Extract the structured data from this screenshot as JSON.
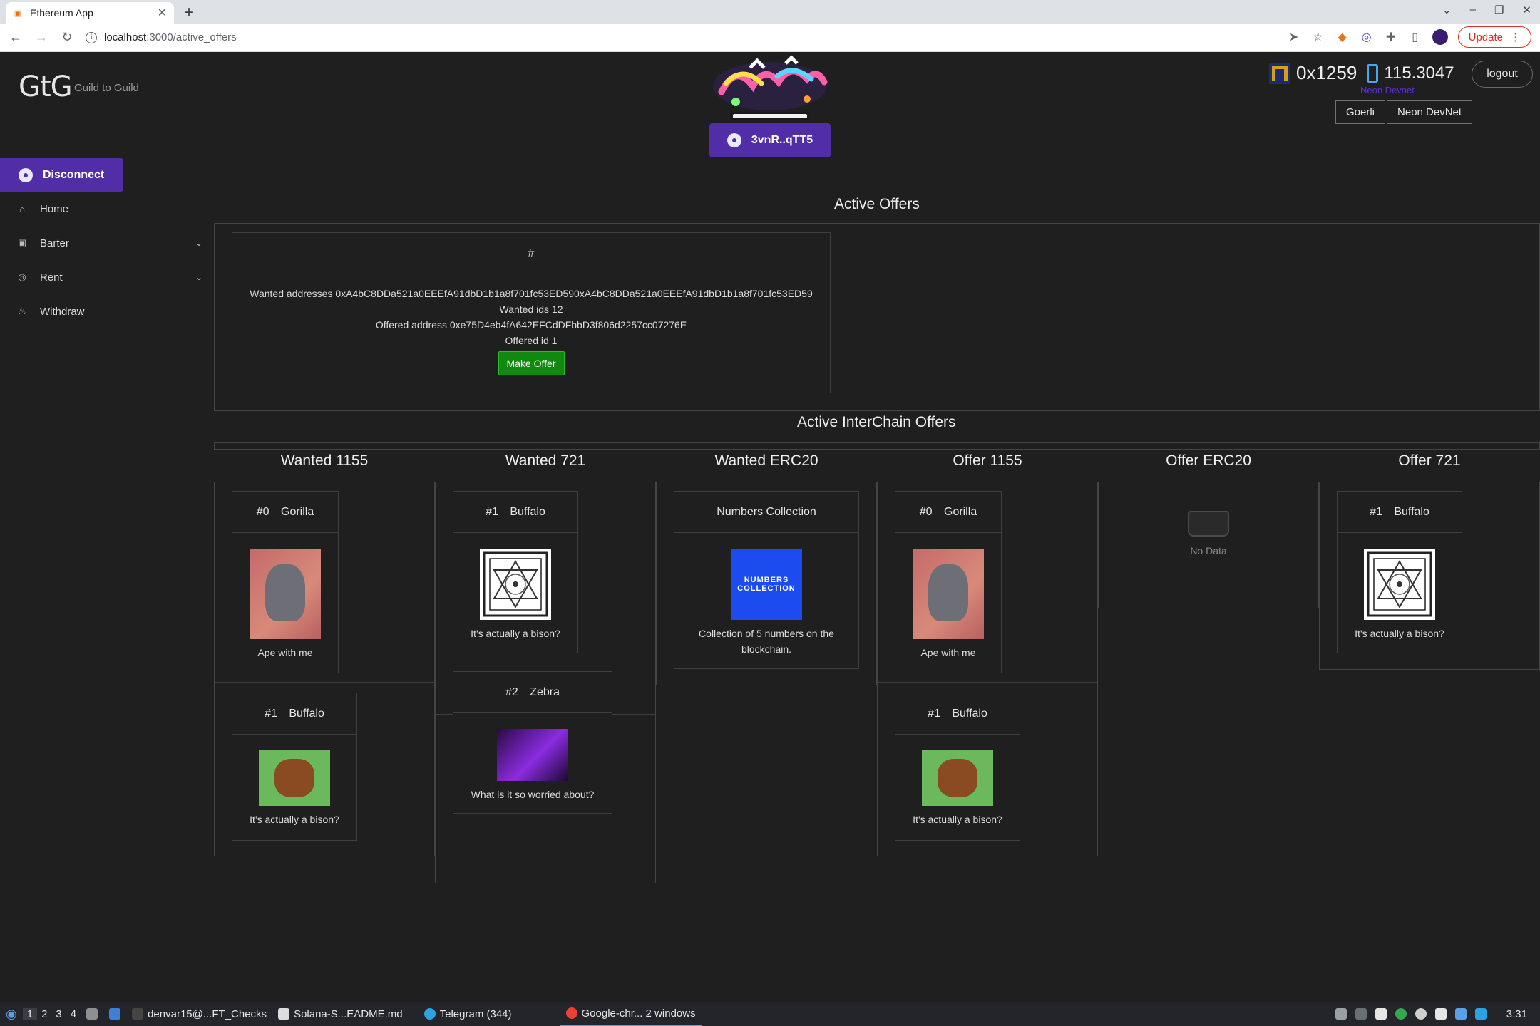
{
  "browser": {
    "tab_title": "Ethereum App",
    "url_host": "localhost",
    "url_path": ":3000/active_offers",
    "update_label": "Update"
  },
  "header": {
    "logo": "GtG",
    "logo_subtitle": "Guild to Guild",
    "wallet_button": "3vnR..qTT5",
    "account_address": "0x1259",
    "balance": "115.3047",
    "network_label": "Neon Devnet",
    "logout": "logout",
    "networks": [
      "Goerli",
      "Neon DevNet"
    ]
  },
  "sidebar": {
    "disconnect": "Disconnect",
    "items": [
      {
        "label": "Home",
        "icon": "home-icon"
      },
      {
        "label": "Barter",
        "icon": "barter-icon"
      },
      {
        "label": "Rent",
        "icon": "rent-icon"
      },
      {
        "label": "Withdraw",
        "icon": "withdraw-icon"
      }
    ]
  },
  "active_offers": {
    "title": "Active Offers",
    "card_header": "#",
    "wanted_addresses": "Wanted addresses 0xA4bC8DDa521a0EEEfA91dbD1b1a8f701fc53ED590xA4bC8DDa521a0EEEfA91dbD1b1a8f701fc53ED59",
    "wanted_ids": "Wanted ids 12",
    "offered_address": "Offered address 0xe75D4eb4fA642EFCdDFbbD3f806d2257cc07276E",
    "offered_id": "Offered id 1",
    "make_offer": "Make Offer"
  },
  "interchain": {
    "title": "Active InterChain Offers",
    "columns": [
      "Wanted 1155",
      "Wanted 721",
      "Wanted ERC20",
      "Offer 1155",
      "Offer ERC20",
      "Offer 721"
    ],
    "no_data": "No Data",
    "cards": {
      "w1155_a": {
        "num": "#0",
        "name": "Gorilla",
        "caption": "Ape with me"
      },
      "w1155_b": {
        "num": "#1",
        "name": "Buffalo",
        "caption": "It's actually a bison?"
      },
      "w721_a": {
        "num": "#1",
        "name": "Buffalo",
        "caption": "It's actually a bison?"
      },
      "w721_b": {
        "num": "#2",
        "name": "Zebra",
        "caption": "What is it so worried about?"
      },
      "werc20_a": {
        "name": "Numbers Collection",
        "image_text": "NUMBERS COLLECTION",
        "caption": "Collection of 5 numbers on the blockchain."
      },
      "o1155_a": {
        "num": "#0",
        "name": "Gorilla",
        "caption": "Ape with me"
      },
      "o1155_b": {
        "num": "#1",
        "name": "Buffalo",
        "caption": "It's actually a bison?"
      },
      "o721_a": {
        "num": "#1",
        "name": "Buffalo",
        "caption": "It's actually a bison?"
      }
    }
  },
  "taskbar": {
    "workspaces": [
      "1",
      "2",
      "3",
      "4"
    ],
    "apps": [
      "denvar15@...FT_Checks",
      "Solana-S...EADME.md",
      "Telegram (344)",
      "Google-chr... 2 windows"
    ],
    "clock": "3:31"
  }
}
